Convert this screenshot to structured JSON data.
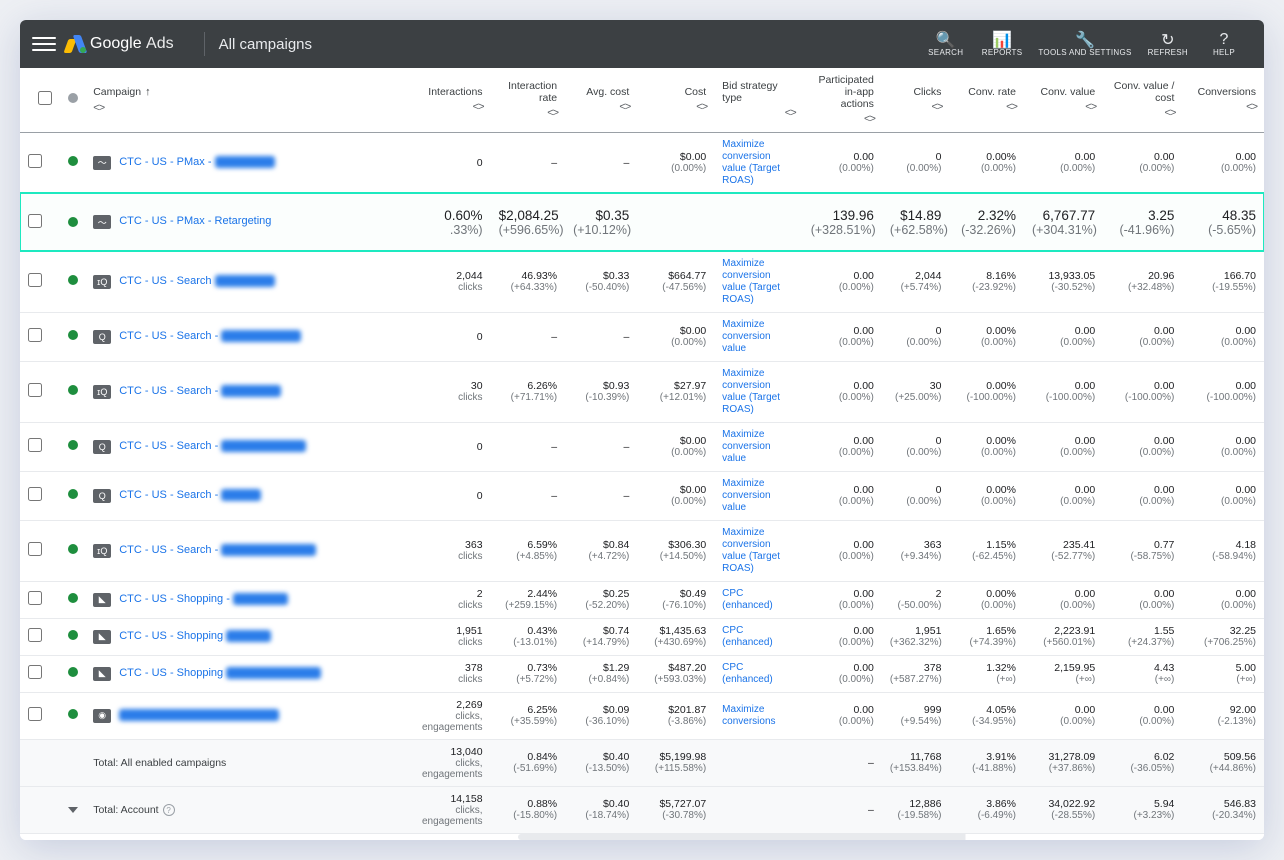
{
  "topbar": {
    "logo_primary": "Google",
    "logo_secondary": "Ads",
    "breadcrumb": "All campaigns",
    "tools": [
      {
        "icon": "🔍",
        "label": "SEARCH"
      },
      {
        "icon": "📊",
        "label": "REPORTS"
      },
      {
        "icon": "🔧",
        "label": "TOOLS AND SETTINGS"
      },
      {
        "icon": "↻",
        "label": "REFRESH"
      },
      {
        "icon": "?",
        "label": "HELP"
      }
    ]
  },
  "columns": [
    {
      "key": "check",
      "label": ""
    },
    {
      "key": "status",
      "label": ""
    },
    {
      "key": "campaign",
      "label": "Campaign",
      "sorted": true
    },
    {
      "key": "interactions",
      "label": "Interactions"
    },
    {
      "key": "int_rate",
      "label": "Interaction rate"
    },
    {
      "key": "avg_cost",
      "label": "Avg. cost"
    },
    {
      "key": "cost",
      "label": "Cost"
    },
    {
      "key": "bid",
      "label": "Bid strategy type"
    },
    {
      "key": "participated",
      "label": "Participated in-app actions"
    },
    {
      "key": "clicks",
      "label": "Clicks"
    },
    {
      "key": "conv_rate",
      "label": "Conv. rate"
    },
    {
      "key": "conv_value",
      "label": "Conv. value"
    },
    {
      "key": "conv_value_cost",
      "label": "Conv. value / cost"
    },
    {
      "key": "conversions",
      "label": "Conversions"
    }
  ],
  "highlight_extra": {
    "v1": {
      "val": "3.25",
      "sub": "(-41.96%)"
    },
    "v2": {
      "val": "48.35",
      "sub": "(-5.65%)"
    }
  },
  "rows": [
    {
      "type": "data",
      "icon": "pmax",
      "icon_txt": "〜",
      "name": "CTC - US - PMax -",
      "blur_w": 60,
      "interactions": {
        "val": "0",
        "sub": ""
      },
      "int_rate": {
        "val": "–",
        "sub": ""
      },
      "avg_cost": {
        "val": "–",
        "sub": ""
      },
      "cost": {
        "val": "$0.00",
        "sub": "(0.00%)"
      },
      "bid": "Maximize conversion value (Target ROAS)",
      "participated": {
        "val": "0.00",
        "sub": "(0.00%)"
      },
      "clicks": {
        "val": "0",
        "sub": "(0.00%)"
      },
      "conv_rate": {
        "val": "0.00%",
        "sub": "(0.00%)"
      },
      "conv_value": {
        "val": "0.00",
        "sub": "(0.00%)"
      },
      "conv_value_cost": {
        "val": "0.00",
        "sub": "(0.00%)"
      },
      "conversions": {
        "val": "0.00",
        "sub": "(0.00%)"
      }
    },
    {
      "type": "highlight",
      "icon": "pmax",
      "icon_txt": "〜",
      "name": "CTC - US - PMax - Retargeting",
      "blur_w": 0,
      "interactions": {
        "val": "0.60%",
        "sub": ".33%)"
      },
      "int_rate": {
        "val": "$2,084.25",
        "sub": "(+596.65%)"
      },
      "avg_cost": {
        "val": "$0.35",
        "sub": "(+10.12%)"
      },
      "cost": {
        "val": "",
        "sub": ""
      },
      "bid": "",
      "participated": {
        "val": "139.96",
        "sub": "(+328.51%)"
      },
      "clicks": {
        "val": "$14.89",
        "sub": "(+62.58%)"
      },
      "conv_rate": {
        "val": "2.32%",
        "sub": "(-32.26%)"
      },
      "conv_value": {
        "val": "6,767.77",
        "sub": "(+304.31%)"
      },
      "conv_value_cost": {
        "val": "",
        "sub": ""
      },
      "conversions": {
        "val": "",
        "sub": ""
      }
    },
    {
      "type": "data",
      "icon": "search",
      "icon_txt": "ɪQ",
      "name": "CTC - US - Search",
      "blur_w": 60,
      "interactions": {
        "val": "2,044",
        "sub": "clicks"
      },
      "int_rate": {
        "val": "46.93%",
        "sub": "(+64.33%)"
      },
      "avg_cost": {
        "val": "$0.33",
        "sub": "(-50.40%)"
      },
      "cost": {
        "val": "$664.77",
        "sub": "(-47.56%)"
      },
      "bid": "Maximize conversion value (Target ROAS)",
      "participated": {
        "val": "0.00",
        "sub": "(0.00%)"
      },
      "clicks": {
        "val": "2,044",
        "sub": "(+5.74%)"
      },
      "conv_rate": {
        "val": "8.16%",
        "sub": "(-23.92%)"
      },
      "conv_value": {
        "val": "13,933.05",
        "sub": "(-30.52%)"
      },
      "conv_value_cost": {
        "val": "20.96",
        "sub": "(+32.48%)"
      },
      "conversions": {
        "val": "166.70",
        "sub": "(-19.55%)"
      }
    },
    {
      "type": "data",
      "icon": "search",
      "icon_txt": "Q",
      "name": "CTC - US - Search -",
      "blur_w": 80,
      "interactions": {
        "val": "0",
        "sub": ""
      },
      "int_rate": {
        "val": "–",
        "sub": ""
      },
      "avg_cost": {
        "val": "–",
        "sub": ""
      },
      "cost": {
        "val": "$0.00",
        "sub": "(0.00%)"
      },
      "bid": "Maximize conversion value",
      "participated": {
        "val": "0.00",
        "sub": "(0.00%)"
      },
      "clicks": {
        "val": "0",
        "sub": "(0.00%)"
      },
      "conv_rate": {
        "val": "0.00%",
        "sub": "(0.00%)"
      },
      "conv_value": {
        "val": "0.00",
        "sub": "(0.00%)"
      },
      "conv_value_cost": {
        "val": "0.00",
        "sub": "(0.00%)"
      },
      "conversions": {
        "val": "0.00",
        "sub": "(0.00%)"
      }
    },
    {
      "type": "data",
      "icon": "search",
      "icon_txt": "ɪQ",
      "name": "CTC - US - Search -",
      "blur_w": 60,
      "interactions": {
        "val": "30",
        "sub": "clicks"
      },
      "int_rate": {
        "val": "6.26%",
        "sub": "(+71.71%)"
      },
      "avg_cost": {
        "val": "$0.93",
        "sub": "(-10.39%)"
      },
      "cost": {
        "val": "$27.97",
        "sub": "(+12.01%)"
      },
      "bid": "Maximize conversion value (Target ROAS)",
      "participated": {
        "val": "0.00",
        "sub": "(0.00%)"
      },
      "clicks": {
        "val": "30",
        "sub": "(+25.00%)"
      },
      "conv_rate": {
        "val": "0.00%",
        "sub": "(-100.00%)"
      },
      "conv_value": {
        "val": "0.00",
        "sub": "(-100.00%)"
      },
      "conv_value_cost": {
        "val": "0.00",
        "sub": "(-100.00%)"
      },
      "conversions": {
        "val": "0.00",
        "sub": "(-100.00%)"
      }
    },
    {
      "type": "data",
      "icon": "search",
      "icon_txt": "Q",
      "name": "CTC - US - Search -",
      "blur_w": 85,
      "interactions": {
        "val": "0",
        "sub": ""
      },
      "int_rate": {
        "val": "–",
        "sub": ""
      },
      "avg_cost": {
        "val": "–",
        "sub": ""
      },
      "cost": {
        "val": "$0.00",
        "sub": "(0.00%)"
      },
      "bid": "Maximize conversion value",
      "participated": {
        "val": "0.00",
        "sub": "(0.00%)"
      },
      "clicks": {
        "val": "0",
        "sub": "(0.00%)"
      },
      "conv_rate": {
        "val": "0.00%",
        "sub": "(0.00%)"
      },
      "conv_value": {
        "val": "0.00",
        "sub": "(0.00%)"
      },
      "conv_value_cost": {
        "val": "0.00",
        "sub": "(0.00%)"
      },
      "conversions": {
        "val": "0.00",
        "sub": "(0.00%)"
      }
    },
    {
      "type": "data",
      "icon": "search",
      "icon_txt": "Q",
      "name": "CTC - US - Search -",
      "blur_w": 40,
      "interactions": {
        "val": "0",
        "sub": ""
      },
      "int_rate": {
        "val": "–",
        "sub": ""
      },
      "avg_cost": {
        "val": "–",
        "sub": ""
      },
      "cost": {
        "val": "$0.00",
        "sub": "(0.00%)"
      },
      "bid": "Maximize conversion value",
      "participated": {
        "val": "0.00",
        "sub": "(0.00%)"
      },
      "clicks": {
        "val": "0",
        "sub": "(0.00%)"
      },
      "conv_rate": {
        "val": "0.00%",
        "sub": "(0.00%)"
      },
      "conv_value": {
        "val": "0.00",
        "sub": "(0.00%)"
      },
      "conv_value_cost": {
        "val": "0.00",
        "sub": "(0.00%)"
      },
      "conversions": {
        "val": "0.00",
        "sub": "(0.00%)"
      }
    },
    {
      "type": "data",
      "icon": "search",
      "icon_txt": "ɪQ",
      "name": "CTC - US - Search -",
      "blur_w": 95,
      "interactions": {
        "val": "363",
        "sub": "clicks"
      },
      "int_rate": {
        "val": "6.59%",
        "sub": "(+4.85%)"
      },
      "avg_cost": {
        "val": "$0.84",
        "sub": "(+4.72%)"
      },
      "cost": {
        "val": "$306.30",
        "sub": "(+14.50%)"
      },
      "bid": "Maximize conversion value (Target ROAS)",
      "participated": {
        "val": "0.00",
        "sub": "(0.00%)"
      },
      "clicks": {
        "val": "363",
        "sub": "(+9.34%)"
      },
      "conv_rate": {
        "val": "1.15%",
        "sub": "(-62.45%)"
      },
      "conv_value": {
        "val": "235.41",
        "sub": "(-52.77%)"
      },
      "conv_value_cost": {
        "val": "0.77",
        "sub": "(-58.75%)"
      },
      "conversions": {
        "val": "4.18",
        "sub": "(-58.94%)"
      }
    },
    {
      "type": "data",
      "icon": "shop",
      "icon_txt": "◣",
      "name": "CTC - US - Shopping -",
      "blur_w": 55,
      "interactions": {
        "val": "2",
        "sub": "clicks"
      },
      "int_rate": {
        "val": "2.44%",
        "sub": "(+259.15%)"
      },
      "avg_cost": {
        "val": "$0.25",
        "sub": "(-52.20%)"
      },
      "cost": {
        "val": "$0.49",
        "sub": "(-76.10%)"
      },
      "bid": "CPC (enhanced)",
      "participated": {
        "val": "0.00",
        "sub": "(0.00%)"
      },
      "clicks": {
        "val": "2",
        "sub": "(-50.00%)"
      },
      "conv_rate": {
        "val": "0.00%",
        "sub": "(0.00%)"
      },
      "conv_value": {
        "val": "0.00",
        "sub": "(0.00%)"
      },
      "conv_value_cost": {
        "val": "0.00",
        "sub": "(0.00%)"
      },
      "conversions": {
        "val": "0.00",
        "sub": "(0.00%)"
      }
    },
    {
      "type": "data",
      "icon": "shop",
      "icon_txt": "◣",
      "name": "CTC - US - Shopping",
      "blur_w": 45,
      "interactions": {
        "val": "1,951",
        "sub": "clicks"
      },
      "int_rate": {
        "val": "0.43%",
        "sub": "(-13.01%)"
      },
      "avg_cost": {
        "val": "$0.74",
        "sub": "(+14.79%)"
      },
      "cost": {
        "val": "$1,435.63",
        "sub": "(+430.69%)"
      },
      "bid": "CPC (enhanced)",
      "participated": {
        "val": "0.00",
        "sub": "(0.00%)"
      },
      "clicks": {
        "val": "1,951",
        "sub": "(+362.32%)"
      },
      "conv_rate": {
        "val": "1.65%",
        "sub": "(+74.39%)"
      },
      "conv_value": {
        "val": "2,223.91",
        "sub": "(+560.01%)"
      },
      "conv_value_cost": {
        "val": "1.55",
        "sub": "(+24.37%)"
      },
      "conversions": {
        "val": "32.25",
        "sub": "(+706.25%)"
      }
    },
    {
      "type": "data",
      "icon": "shop",
      "icon_txt": "◣",
      "name": "CTC - US - Shopping",
      "blur_w": 95,
      "interactions": {
        "val": "378",
        "sub": "clicks"
      },
      "int_rate": {
        "val": "0.73%",
        "sub": "(+5.72%)"
      },
      "avg_cost": {
        "val": "$1.29",
        "sub": "(+0.84%)"
      },
      "cost": {
        "val": "$487.20",
        "sub": "(+593.03%)"
      },
      "bid": "CPC (enhanced)",
      "participated": {
        "val": "0.00",
        "sub": "(0.00%)"
      },
      "clicks": {
        "val": "378",
        "sub": "(+587.27%)"
      },
      "conv_rate": {
        "val": "1.32%",
        "sub": "(+∞)"
      },
      "conv_value": {
        "val": "2,159.95",
        "sub": "(+∞)"
      },
      "conv_value_cost": {
        "val": "4.43",
        "sub": "(+∞)"
      },
      "conversions": {
        "val": "5.00",
        "sub": "(+∞)"
      }
    },
    {
      "type": "data",
      "icon": "other",
      "icon_txt": "◉",
      "name": "",
      "blur_w": 160,
      "interactions": {
        "val": "2,269",
        "sub": "clicks, engagements"
      },
      "int_rate": {
        "val": "6.25%",
        "sub": "(+35.59%)"
      },
      "avg_cost": {
        "val": "$0.09",
        "sub": "(-36.10%)"
      },
      "cost": {
        "val": "$201.87",
        "sub": "(-3.86%)"
      },
      "bid": "Maximize conversions",
      "participated": {
        "val": "0.00",
        "sub": "(0.00%)"
      },
      "clicks": {
        "val": "999",
        "sub": "(+9.54%)"
      },
      "conv_rate": {
        "val": "4.05%",
        "sub": "(-34.95%)"
      },
      "conv_value": {
        "val": "0.00",
        "sub": "(0.00%)"
      },
      "conv_value_cost": {
        "val": "0.00",
        "sub": "(0.00%)"
      },
      "conversions": {
        "val": "92.00",
        "sub": "(-2.13%)"
      }
    },
    {
      "type": "total",
      "name": "Total: All enabled campaigns",
      "interactions": {
        "val": "13,040",
        "sub": "clicks, engagements"
      },
      "int_rate": {
        "val": "0.84%",
        "sub": "(-51.69%)"
      },
      "avg_cost": {
        "val": "$0.40",
        "sub": "(-13.50%)"
      },
      "cost": {
        "val": "$5,199.98",
        "sub": "(+115.58%)"
      },
      "bid": "",
      "participated": {
        "val": "–",
        "sub": ""
      },
      "clicks": {
        "val": "11,768",
        "sub": "(+153.84%)"
      },
      "conv_rate": {
        "val": "3.91%",
        "sub": "(-41.88%)"
      },
      "conv_value": {
        "val": "31,278.09",
        "sub": "(+37.86%)"
      },
      "conv_value_cost": {
        "val": "6.02",
        "sub": "(-36.05%)"
      },
      "conversions": {
        "val": "509.56",
        "sub": "(+44.86%)"
      }
    },
    {
      "type": "total",
      "name": "Total: Account",
      "expand": true,
      "interactions": {
        "val": "14,158",
        "sub": "clicks, engagements"
      },
      "int_rate": {
        "val": "0.88%",
        "sub": "(-15.80%)"
      },
      "avg_cost": {
        "val": "$0.40",
        "sub": "(-18.74%)"
      },
      "cost": {
        "val": "$5,727.07",
        "sub": "(-30.78%)"
      },
      "bid": "",
      "participated": {
        "val": "–",
        "sub": ""
      },
      "clicks": {
        "val": "12,886",
        "sub": "(-19.58%)"
      },
      "conv_rate": {
        "val": "3.86%",
        "sub": "(-6.49%)"
      },
      "conv_value": {
        "val": "34,022.92",
        "sub": "(-28.55%)"
      },
      "conv_value_cost": {
        "val": "5.94",
        "sub": "(+3.23%)"
      },
      "conversions": {
        "val": "546.83",
        "sub": "(-20.34%)"
      }
    }
  ]
}
